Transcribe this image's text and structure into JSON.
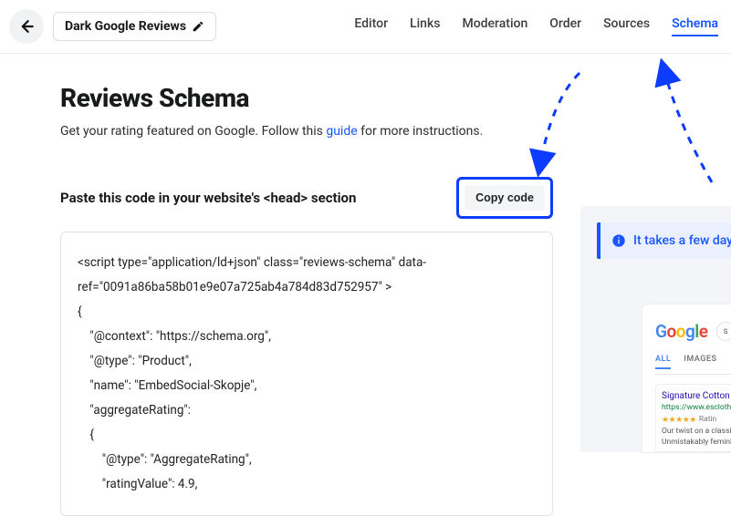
{
  "header": {
    "title": "Dark Google Reviews",
    "nav": [
      "Editor",
      "Links",
      "Moderation",
      "Order",
      "Sources",
      "Schema"
    ],
    "active_nav": "Schema"
  },
  "page": {
    "heading": "Reviews Schema",
    "subtitle_before": "Get your rating featured on Google. Follow this ",
    "subtitle_link": "guide",
    "subtitle_after": " for more instructions.",
    "paste_label": "Paste this code in your website's <head> section",
    "copy_button": "Copy code",
    "code": "<script type=\"application/ld+json\" class=\"reviews-schema\" data-ref=\"0091a86ba58b01e9e07a725ab4a784d83d752957\" >\n{\n    \"@context\": \"https://schema.org\",\n    \"@type\": \"Product\",\n    \"name\": \"EmbedSocial-Skopje\",\n    \"aggregateRating\":\n    {\n        \"@type\": \"AggregateRating\",\n        \"ratingValue\": 4.9,"
  },
  "right": {
    "notice": "It takes a few days",
    "google_tabs": {
      "all": "ALL",
      "images": "IMAGES"
    },
    "search_placeholder": "s",
    "result": {
      "title": "Signature Cotton Fis",
      "url": "https://www.esclothes",
      "rating_label": "Ratin",
      "desc1": "Our twist on a classic",
      "desc2": "Unmistakably femini"
    }
  }
}
